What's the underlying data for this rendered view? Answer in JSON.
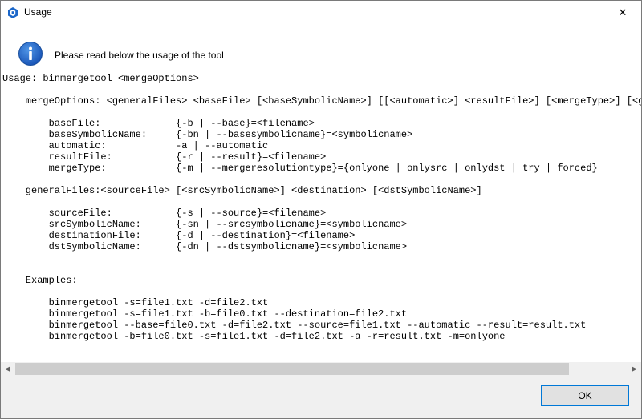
{
  "window": {
    "title": "Usage",
    "close_glyph": "✕"
  },
  "icons": {
    "app": "app-logo-icon",
    "info": "info-icon",
    "accent_color": "#1a66c9"
  },
  "message": "Please read below the usage of the tool",
  "usage_lines": [
    "Usage: binmergetool <mergeOptions>",
    "",
    "    mergeOptions: <generalFiles> <baseFile> [<baseSymbolicName>] [[<automatic>] <resultFile>] [<mergeType>] [<gene",
    "",
    "        baseFile:             {-b | --base}=<filename>",
    "        baseSymbolicName:     {-bn | --basesymbolicname}=<symbolicname>",
    "        automatic:            -a | --automatic",
    "        resultFile:           {-r | --result}=<filename>",
    "        mergeType:            {-m | --mergeresolutiontype}={onlyone | onlysrc | onlydst | try | forced}",
    "",
    "    generalFiles:<sourceFile> [<srcSymbolicName>] <destination> [<dstSymbolicName>]",
    "",
    "        sourceFile:           {-s | --source}=<filename>",
    "        srcSymbolicName:      {-sn | --srcsymbolicname}=<symbolicname>",
    "        destinationFile:      {-d | --destination}=<filename>",
    "        dstSymbolicName:      {-dn | --dstsymbolicname}=<symbolicname>",
    "",
    "",
    "    Examples:",
    "",
    "        binmergetool -s=file1.txt -d=file2.txt",
    "        binmergetool -s=file1.txt -b=file0.txt --destination=file2.txt",
    "        binmergetool --base=file0.txt -d=file2.txt --source=file1.txt --automatic --result=result.txt",
    "        binmergetool -b=file0.txt -s=file1.txt -d=file2.txt -a -r=result.txt -m=onlyone"
  ],
  "scrollbar": {
    "left_arrow": "◀",
    "right_arrow": "▶"
  },
  "ok_label": "OK"
}
